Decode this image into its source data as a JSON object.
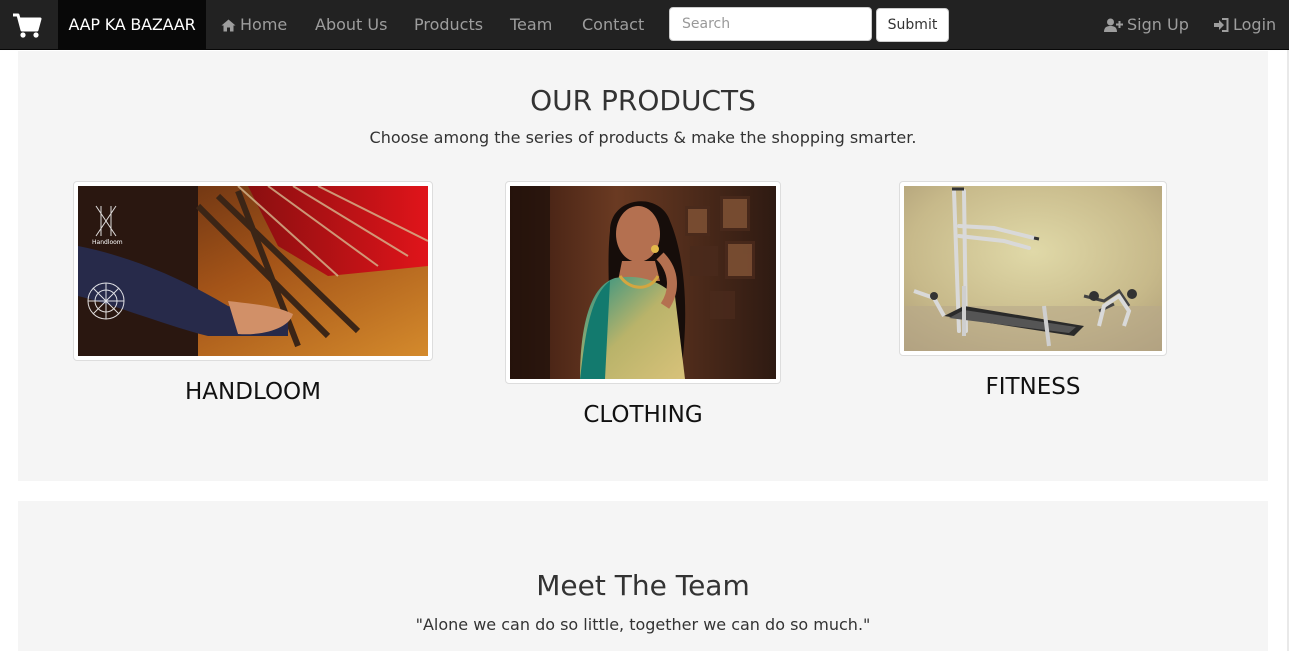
{
  "navbar": {
    "brand": "AAP KA BAZAAR",
    "links": [
      {
        "label": "Home",
        "icon": "home-icon"
      },
      {
        "label": "About Us"
      },
      {
        "label": "Products"
      },
      {
        "label": "Team"
      },
      {
        "label": "Contact"
      }
    ],
    "search": {
      "placeholder": "Search",
      "value": ""
    },
    "submit_label": "Submit",
    "signup_label": "Sign Up",
    "login_label": "Login",
    "cart_icon": "shopping-cart-icon"
  },
  "products_section": {
    "title": "OUR PRODUCTS",
    "subtitle": "Choose among the series of products & make the shopping smarter.",
    "items": [
      {
        "name": "HANDLOOM",
        "image_watermark": "Handloom"
      },
      {
        "name": "CLOTHING"
      },
      {
        "name": "FITNESS"
      }
    ]
  },
  "team_section": {
    "title": "Meet The Team",
    "quote": "\"Alone we can do so little, together we can do so much.\""
  },
  "colors": {
    "navbar_bg": "#222222",
    "brand_bg": "#080808",
    "nav_text": "#9d9d9d",
    "panel_bg": "#f5f5f5"
  }
}
